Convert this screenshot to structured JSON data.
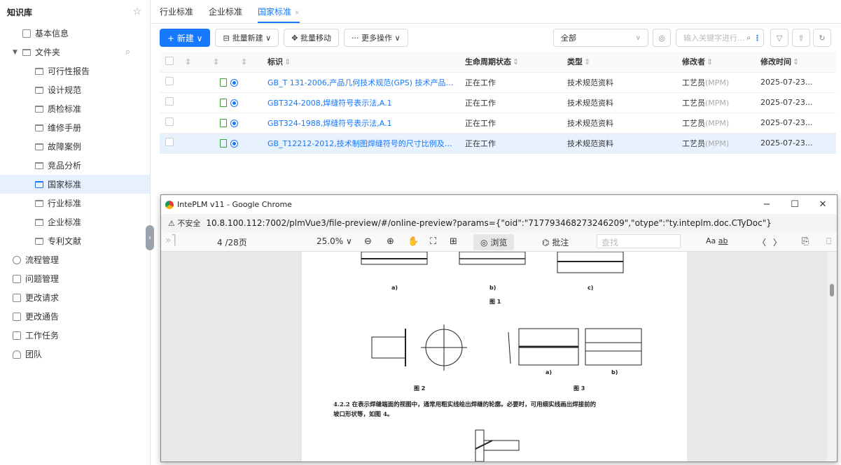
{
  "sidebar": {
    "title": "知识库",
    "items": [
      {
        "label": "基本信息"
      },
      {
        "label": "文件夹"
      },
      {
        "label": "可行性报告"
      },
      {
        "label": "设计规范"
      },
      {
        "label": "质检标准"
      },
      {
        "label": "维修手册"
      },
      {
        "label": "故障案例"
      },
      {
        "label": "竞品分析"
      },
      {
        "label": "国家标准"
      },
      {
        "label": "行业标准"
      },
      {
        "label": "企业标准"
      },
      {
        "label": "专利文献"
      },
      {
        "label": "流程管理"
      },
      {
        "label": "问题管理"
      },
      {
        "label": "更改请求"
      },
      {
        "label": "更改通告"
      },
      {
        "label": "工作任务"
      },
      {
        "label": "团队"
      }
    ]
  },
  "tabs": [
    {
      "label": "行业标准"
    },
    {
      "label": "企业标准"
    },
    {
      "label": "国家标准"
    }
  ],
  "toolbar": {
    "new_label": "+ 新建 ∨",
    "batch_new_label": "批量新建 ∨",
    "batch_move_label": "✥ 批量移动",
    "more_label": "··· 更多操作 ∨",
    "filter_value": "全部",
    "search_placeholder": "输入关键字进行..."
  },
  "table": {
    "headers": [
      "标识",
      "生命周期状态",
      "类型",
      "修改者",
      "修改时间"
    ],
    "rows": [
      {
        "id": "GB_T 131-2006,产品几何技术规范(GPS) 技术产品文...",
        "state": "正在工作",
        "type": "技术规范资料",
        "modifier": "工艺员",
        "modifier_org": "(MPM)",
        "time": "2025-07-23..."
      },
      {
        "id": "GBT324-2008,焊缝符号表示法,A.1",
        "state": "正在工作",
        "type": "技术规范资料",
        "modifier": "工艺员",
        "modifier_org": "(MPM)",
        "time": "2025-07-23..."
      },
      {
        "id": "GBT324-1988,焊缝符号表示法,A.1",
        "state": "正在工作",
        "type": "技术规范资料",
        "modifier": "工艺员",
        "modifier_org": "(MPM)",
        "time": "2025-07-23..."
      },
      {
        "id": "GB_T12212-2012,技术制图焊缝符号的尺寸比例及简...",
        "state": "正在工作",
        "type": "技术规范资料",
        "modifier": "工艺员",
        "modifier_org": "(MPM)",
        "time": "2025-07-23..."
      }
    ]
  },
  "chrome": {
    "title": "IntePLM v11 - Google Chrome",
    "insecure": "不安全",
    "url": "10.8.100.112:7002/plmVue3/file-preview/#/online-preview?params={\"oid\":\"717793468273246209\",\"otype\":\"ty.inteplm.doc.CTyDoc\"}"
  },
  "pdf": {
    "page": "4 /28页",
    "zoom": "25.0%",
    "browse_label": "浏览",
    "annotate_label": "批注",
    "find_placeholder": "查找",
    "aa": "Aa",
    "ab": "ab"
  },
  "page_content": {
    "fig_a": "a)",
    "fig_b": "b)",
    "fig_c": "c)",
    "fig1": "图 1",
    "fig2": "图 2",
    "fig3": "图 3",
    "fig3_a": "a)",
    "fig3_b": "b)",
    "para1": "4.2.2 在表示焊缝端面的视图中，通常用粗实线绘出焊缝的轮廓。必要时，可用细实线画出焊接前的",
    "para2": "坡口形状等，如图 4。"
  }
}
